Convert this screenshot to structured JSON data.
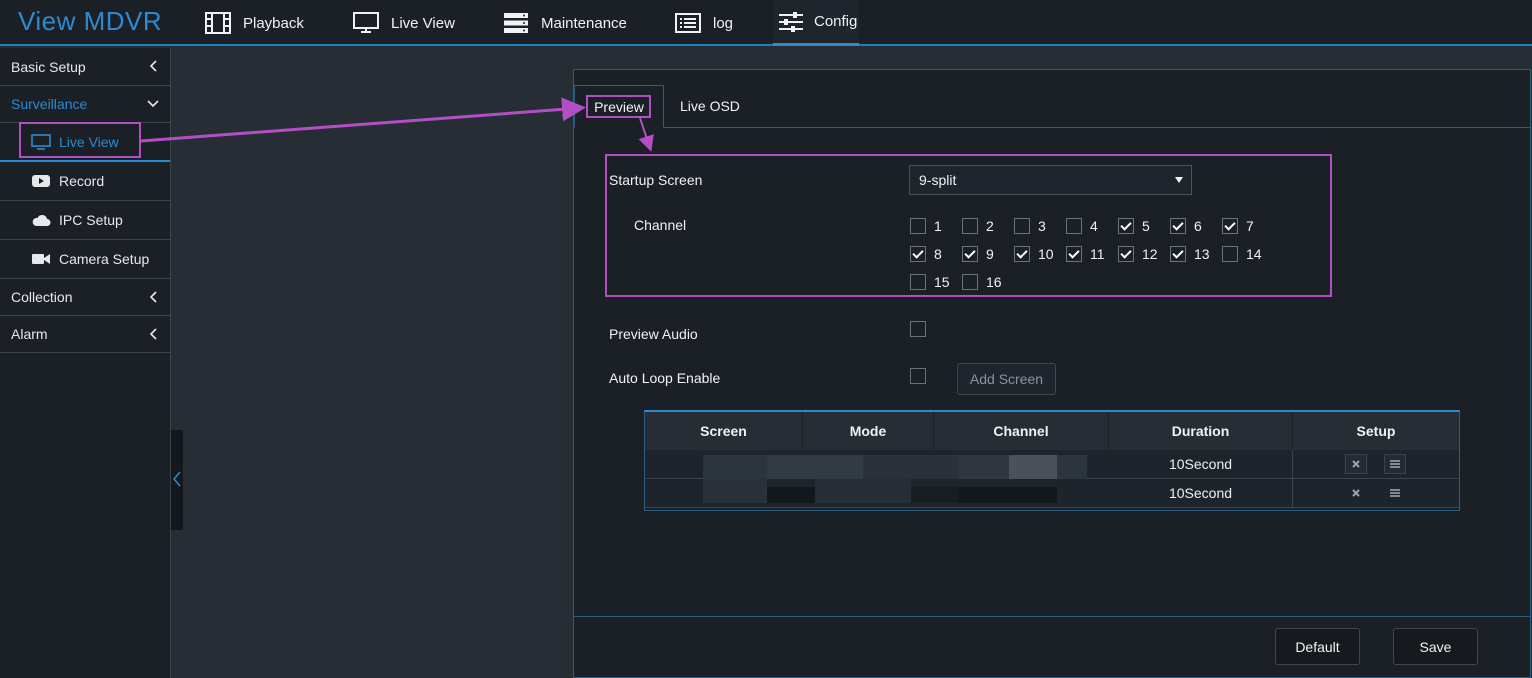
{
  "app": {
    "title": "View MDVR"
  },
  "nav": {
    "items": [
      {
        "label": "Playback",
        "icon": "film-icon"
      },
      {
        "label": "Live View",
        "icon": "monitor-icon"
      },
      {
        "label": "Maintenance",
        "icon": "server-icon"
      },
      {
        "label": "log",
        "icon": "list-icon"
      },
      {
        "label": "Config",
        "icon": "sliders-icon",
        "active": true
      }
    ]
  },
  "sidebar": {
    "sections": [
      {
        "label": "Basic Setup",
        "state": "collapsed"
      },
      {
        "label": "Surveillance",
        "state": "expanded",
        "children": [
          {
            "label": "Live View",
            "icon": "monitor-icon",
            "active": true
          },
          {
            "label": "Record",
            "icon": "play-icon"
          },
          {
            "label": "IPC Setup",
            "icon": "cloud-icon"
          },
          {
            "label": "Camera Setup",
            "icon": "camera-icon"
          }
        ]
      },
      {
        "label": "Collection",
        "state": "collapsed"
      },
      {
        "label": "Alarm",
        "state": "collapsed"
      }
    ]
  },
  "tabs": [
    {
      "label": "Preview",
      "active": true
    },
    {
      "label": "Live OSD"
    }
  ],
  "form": {
    "startup_screen_label": "Startup Screen",
    "startup_screen_value": "9-split",
    "channel_label": "Channel",
    "channels": [
      {
        "n": "1",
        "checked": false
      },
      {
        "n": "2",
        "checked": false
      },
      {
        "n": "3",
        "checked": false
      },
      {
        "n": "4",
        "checked": false
      },
      {
        "n": "5",
        "checked": true
      },
      {
        "n": "6",
        "checked": true
      },
      {
        "n": "7",
        "checked": true
      },
      {
        "n": "8",
        "checked": true
      },
      {
        "n": "9",
        "checked": true
      },
      {
        "n": "10",
        "checked": true
      },
      {
        "n": "11",
        "checked": true
      },
      {
        "n": "12",
        "checked": true
      },
      {
        "n": "13",
        "checked": true
      },
      {
        "n": "14",
        "checked": false
      },
      {
        "n": "15",
        "checked": false
      },
      {
        "n": "16",
        "checked": false
      }
    ],
    "preview_audio_label": "Preview Audio",
    "preview_audio_checked": false,
    "auto_loop_label": "Auto Loop Enable",
    "auto_loop_checked": false,
    "add_screen_label": "Add Screen"
  },
  "table": {
    "headers": [
      "Screen",
      "Mode",
      "Channel",
      "Duration",
      "Setup"
    ],
    "rows": [
      {
        "screen": "",
        "mode": "",
        "channel": "",
        "duration": "10Second"
      },
      {
        "screen": "",
        "mode": "",
        "channel": "",
        "duration": "10Second"
      }
    ]
  },
  "buttons": {
    "default_label": "Default",
    "save_label": "Save"
  },
  "colors": {
    "accent": "#2c8bd0",
    "annotation": "#b24fc4",
    "background": "#1b2026"
  }
}
